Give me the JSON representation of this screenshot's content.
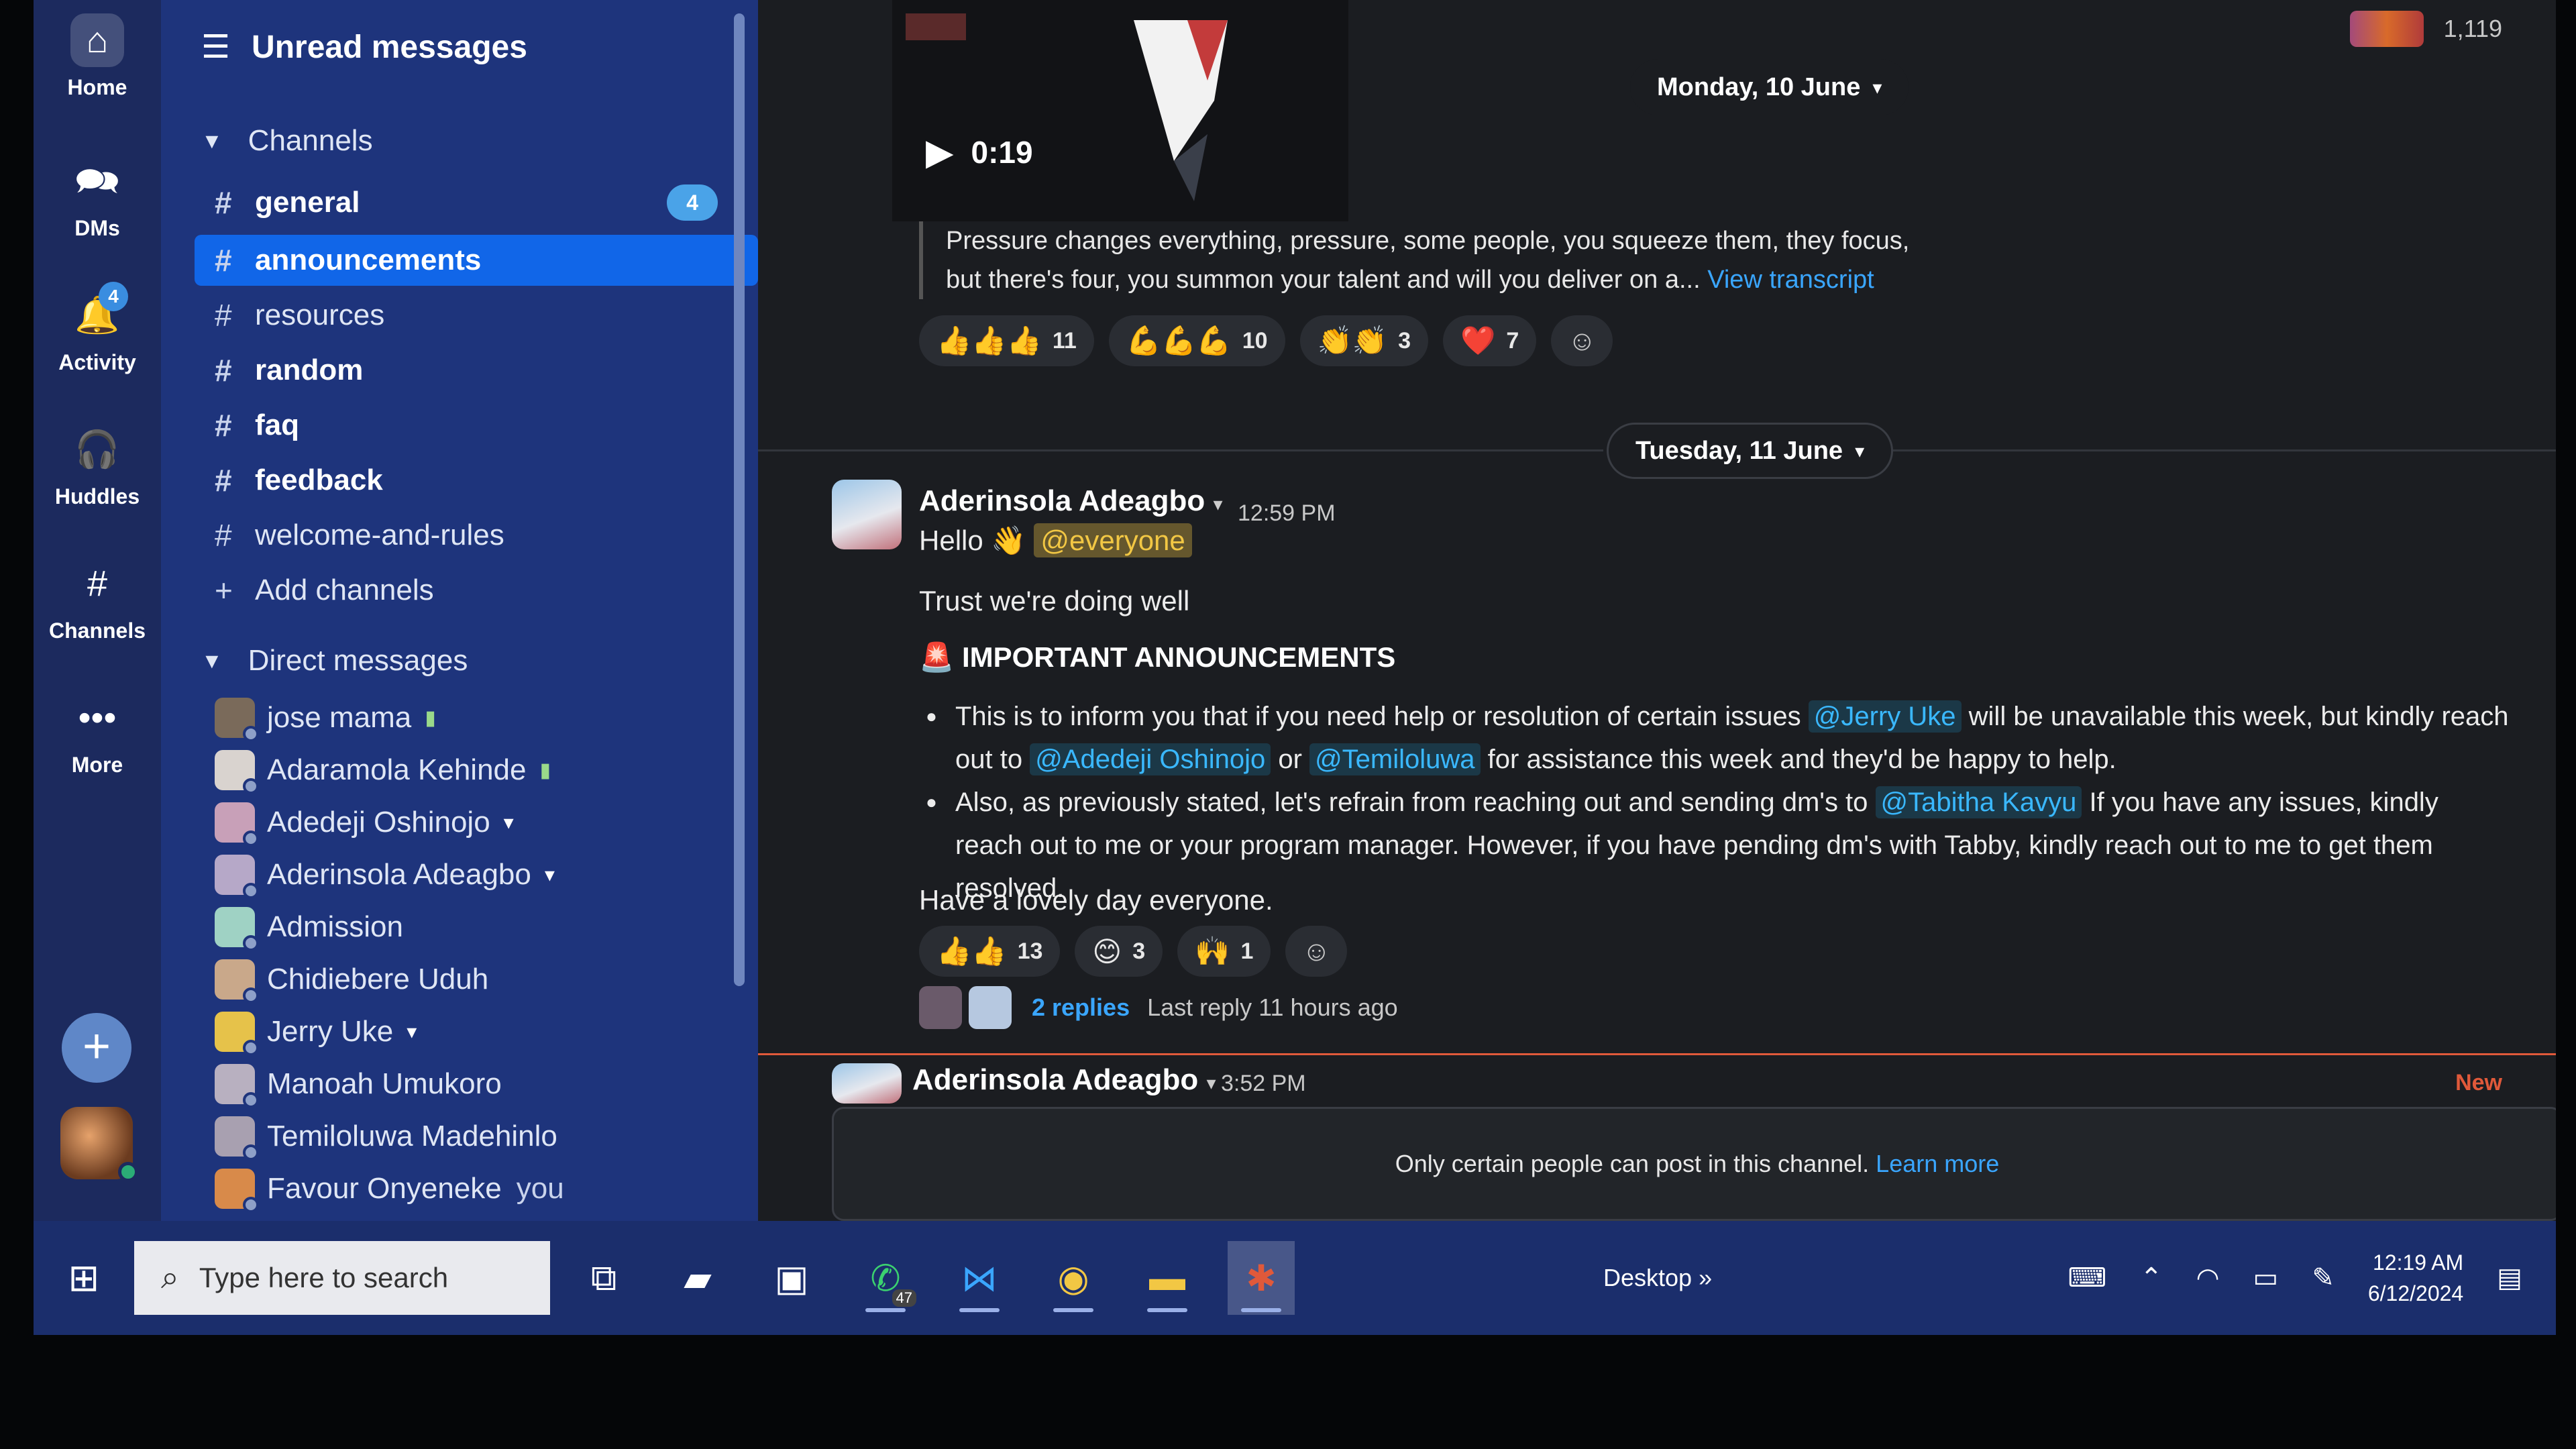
{
  "rail": {
    "items": [
      {
        "label": "Home",
        "icon": "home-icon"
      },
      {
        "label": "DMs",
        "icon": "dms-icon"
      },
      {
        "label": "Activity",
        "icon": "bell-icon",
        "badge": "4"
      },
      {
        "label": "Huddles",
        "icon": "headphones-icon"
      },
      {
        "label": "Channels",
        "icon": "hash-icon"
      },
      {
        "label": "More",
        "icon": "more-icon"
      }
    ]
  },
  "sidebar": {
    "title": "Unread messages",
    "channels_header": "Channels",
    "channels": [
      {
        "name": "general",
        "bold": true,
        "count": "4"
      },
      {
        "name": "announcements",
        "active": true
      },
      {
        "name": "resources"
      },
      {
        "name": "random",
        "bold": true
      },
      {
        "name": "faq",
        "bold": true
      },
      {
        "name": "feedback",
        "bold": true
      },
      {
        "name": "welcome-and-rules"
      }
    ],
    "add_channels": "Add channels",
    "dm_header": "Direct messages",
    "dms": [
      {
        "name": "jose mama"
      },
      {
        "name": "Adaramola Kehinde"
      },
      {
        "name": "Adedeji Oshinojo"
      },
      {
        "name": "Aderinsola Adeagbo"
      },
      {
        "name": "Admission"
      },
      {
        "name": "Chidiebere Uduh"
      },
      {
        "name": "Jerry Uke"
      },
      {
        "name": "Manoah Umukoro"
      },
      {
        "name": "Temiloluwa Madehinlo"
      },
      {
        "name": "Favour Onyeneke",
        "you": "you"
      }
    ]
  },
  "main": {
    "member_count": "1,119",
    "video_time": "0:19",
    "date1": "Monday, 10 June",
    "transcript_text": "Pressure changes everything, pressure, some people, you squeeze them, they focus, but there's four, you summon your talent and will you deliver on a...",
    "view_transcript": "View transcript",
    "reactions1": [
      {
        "emoji": "👍👍👍",
        "count": "11"
      },
      {
        "emoji": "💪💪💪",
        "count": "10"
      },
      {
        "emoji": "👏👏",
        "count": "3"
      },
      {
        "emoji": "❤️",
        "count": "7"
      }
    ],
    "date2": "Tuesday, 11 June",
    "message": {
      "author": "Aderinsola Adeagbo",
      "time": "12:59 PM",
      "greeting": "Hello 👋",
      "everyone": "@everyone",
      "line2": "Trust we're doing well",
      "announce_title": "IMPORTANT ANNOUNCEMENTS",
      "b1_part1": "This is to inform you that if you need help or resolution of certain issues",
      "b1_mention1": "@Jerry Uke",
      "b1_part2": "will be unavailable this week, but kindly reach out to",
      "b1_mention2": "@Adedeji Oshinojo",
      "b1_or": "or",
      "b1_mention3": "@Temiloluwa",
      "b1_part3": "for assistance this week and they'd be happy to help.",
      "b2_part1": "Also, as previously stated, let's refrain from reaching out and sending dm's to",
      "b2_mention": "@Tabitha Kavyu",
      "b2_part2": "If you have any issues, kindly reach out to me or your program manager. However, if you have pending dm's with Tabby, kindly reach out to me to get them resolved.",
      "closing": "Have a lovely day everyone.",
      "reactions": [
        {
          "emoji": "👍👍",
          "count": "13"
        },
        {
          "emoji": "😊",
          "count": "3"
        },
        {
          "emoji": "🙌",
          "count": "1"
        }
      ],
      "replies": "2 replies",
      "last_reply": "Last reply 11 hours ago"
    },
    "new_message": {
      "author": "Aderinsola Adeagbo",
      "time": "3:52 PM",
      "new_label": "New"
    },
    "composer_text": "Only certain people can post in this channel.",
    "learn_more": "Learn more"
  },
  "taskbar": {
    "search_placeholder": "Type here to search",
    "desktop_label": "Desktop",
    "time": "12:19 AM",
    "date": "6/12/2024",
    "whatsapp_badge": "47"
  }
}
